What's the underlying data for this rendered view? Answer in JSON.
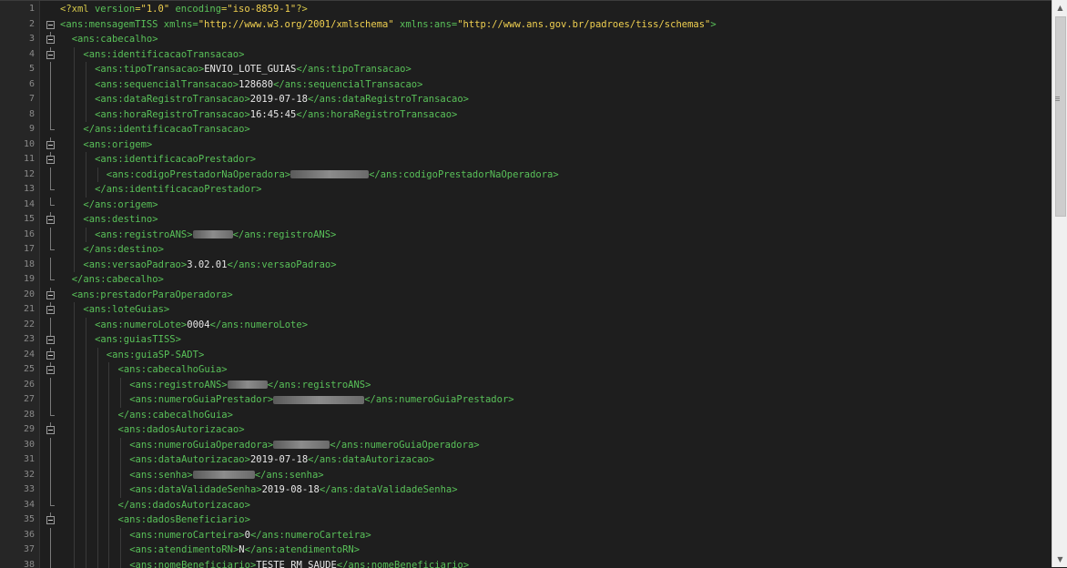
{
  "editor": {
    "lines": [
      {
        "n": "1",
        "indent": 0,
        "fold": "none",
        "segs": [
          [
            "pi",
            "<?xml "
          ],
          [
            "attrn",
            "version"
          ],
          [
            "pi",
            "="
          ],
          [
            "attrv",
            "\"1.0\""
          ],
          [
            "pi",
            " "
          ],
          [
            "attrn",
            "encoding"
          ],
          [
            "pi",
            "="
          ],
          [
            "attrv",
            "\"iso-8859-1\""
          ],
          [
            "pi",
            "?>"
          ]
        ]
      },
      {
        "n": "2",
        "indent": 0,
        "fold": "open",
        "segs": [
          [
            "tag",
            "<ans:mensagemTISS "
          ],
          [
            "attrn",
            "xmlns"
          ],
          [
            "tag",
            "="
          ],
          [
            "attrv",
            "\"http://www.w3.org/2001/xmlschema\""
          ],
          [
            "tag",
            " "
          ],
          [
            "attrn",
            "xmlns:ans"
          ],
          [
            "tag",
            "="
          ],
          [
            "attrv",
            "\"http://www.ans.gov.br/padroes/tiss/schemas\""
          ],
          [
            "tag",
            ">"
          ]
        ]
      },
      {
        "n": "3",
        "indent": 1,
        "fold": "open",
        "segs": [
          [
            "tag",
            "<ans:cabecalho>"
          ]
        ]
      },
      {
        "n": "4",
        "indent": 2,
        "fold": "open",
        "segs": [
          [
            "tag",
            "<ans:identificacaoTransacao>"
          ]
        ]
      },
      {
        "n": "5",
        "indent": 3,
        "fold": "line",
        "segs": [
          [
            "tag",
            "<ans:tipoTransacao>"
          ],
          [
            "txt",
            "ENVIO_LOTE_GUIAS"
          ],
          [
            "tag",
            "</ans:tipoTransacao>"
          ]
        ]
      },
      {
        "n": "6",
        "indent": 3,
        "fold": "line",
        "segs": [
          [
            "tag",
            "<ans:sequencialTransacao>"
          ],
          [
            "txt",
            "128680"
          ],
          [
            "tag",
            "</ans:sequencialTransacao>"
          ]
        ]
      },
      {
        "n": "7",
        "indent": 3,
        "fold": "line",
        "segs": [
          [
            "tag",
            "<ans:dataRegistroTransacao>"
          ],
          [
            "txt",
            "2019-07-18"
          ],
          [
            "tag",
            "</ans:dataRegistroTransacao>"
          ]
        ]
      },
      {
        "n": "8",
        "indent": 3,
        "fold": "line",
        "segs": [
          [
            "tag",
            "<ans:horaRegistroTransacao>"
          ],
          [
            "txt",
            "16:45:45"
          ],
          [
            "tag",
            "</ans:horaRegistroTransacao>"
          ]
        ]
      },
      {
        "n": "9",
        "indent": 2,
        "fold": "end",
        "segs": [
          [
            "tag",
            "</ans:identificacaoTransacao>"
          ]
        ]
      },
      {
        "n": "10",
        "indent": 2,
        "fold": "open",
        "segs": [
          [
            "tag",
            "<ans:origem>"
          ]
        ]
      },
      {
        "n": "11",
        "indent": 3,
        "fold": "open",
        "segs": [
          [
            "tag",
            "<ans:identificacaoPrestador>"
          ]
        ]
      },
      {
        "n": "12",
        "indent": 4,
        "fold": "line",
        "segs": [
          [
            "tag",
            "<ans:codigoPrestadorNaOperadora>"
          ],
          [
            "redact",
            "86"
          ],
          [
            "tag",
            "</ans:codigoPrestadorNaOperadora>"
          ]
        ]
      },
      {
        "n": "13",
        "indent": 3,
        "fold": "end",
        "segs": [
          [
            "tag",
            "</ans:identificacaoPrestador>"
          ]
        ]
      },
      {
        "n": "14",
        "indent": 2,
        "fold": "end",
        "segs": [
          [
            "tag",
            "</ans:origem>"
          ]
        ]
      },
      {
        "n": "15",
        "indent": 2,
        "fold": "open",
        "segs": [
          [
            "tag",
            "<ans:destino>"
          ]
        ]
      },
      {
        "n": "16",
        "indent": 3,
        "fold": "line",
        "segs": [
          [
            "tag",
            "<ans:registroANS>"
          ],
          [
            "redact",
            "44"
          ],
          [
            "tag",
            "</ans:registroANS>"
          ]
        ]
      },
      {
        "n": "17",
        "indent": 2,
        "fold": "end",
        "segs": [
          [
            "tag",
            "</ans:destino>"
          ]
        ]
      },
      {
        "n": "18",
        "indent": 2,
        "fold": "line",
        "segs": [
          [
            "tag",
            "<ans:versaoPadrao>"
          ],
          [
            "txt",
            "3.02.01"
          ],
          [
            "tag",
            "</ans:versaoPadrao>"
          ]
        ]
      },
      {
        "n": "19",
        "indent": 1,
        "fold": "end",
        "segs": [
          [
            "tag",
            "</ans:cabecalho>"
          ]
        ]
      },
      {
        "n": "20",
        "indent": 1,
        "fold": "open",
        "segs": [
          [
            "tag",
            "<ans:prestadorParaOperadora>"
          ]
        ]
      },
      {
        "n": "21",
        "indent": 2,
        "fold": "open",
        "segs": [
          [
            "tag",
            "<ans:loteGuias>"
          ]
        ]
      },
      {
        "n": "22",
        "indent": 3,
        "fold": "line",
        "segs": [
          [
            "tag",
            "<ans:numeroLote>"
          ],
          [
            "txt",
            "0004"
          ],
          [
            "tag",
            "</ans:numeroLote>"
          ]
        ]
      },
      {
        "n": "23",
        "indent": 3,
        "fold": "open",
        "segs": [
          [
            "tag",
            "<ans:guiasTISS>"
          ]
        ]
      },
      {
        "n": "24",
        "indent": 4,
        "fold": "open",
        "segs": [
          [
            "tag",
            "<ans:guiaSP-SADT>"
          ]
        ]
      },
      {
        "n": "25",
        "indent": 5,
        "fold": "open",
        "segs": [
          [
            "tag",
            "<ans:cabecalhoGuia>"
          ]
        ]
      },
      {
        "n": "26",
        "indent": 6,
        "fold": "line",
        "segs": [
          [
            "tag",
            "<ans:registroANS>"
          ],
          [
            "redact",
            "44"
          ],
          [
            "tag",
            "</ans:registroANS>"
          ]
        ]
      },
      {
        "n": "27",
        "indent": 6,
        "fold": "line",
        "segs": [
          [
            "tag",
            "<ans:numeroGuiaPrestador>"
          ],
          [
            "redact",
            "100"
          ],
          [
            "tag",
            "</ans:numeroGuiaPrestador>"
          ]
        ]
      },
      {
        "n": "28",
        "indent": 5,
        "fold": "end",
        "segs": [
          [
            "tag",
            "</ans:cabecalhoGuia>"
          ]
        ]
      },
      {
        "n": "29",
        "indent": 5,
        "fold": "open",
        "segs": [
          [
            "tag",
            "<ans:dadosAutorizacao>"
          ]
        ]
      },
      {
        "n": "30",
        "indent": 6,
        "fold": "line",
        "segs": [
          [
            "tag",
            "<ans:numeroGuiaOperadora>"
          ],
          [
            "redact",
            "62"
          ],
          [
            "tag",
            "</ans:numeroGuiaOperadora>"
          ]
        ]
      },
      {
        "n": "31",
        "indent": 6,
        "fold": "line",
        "segs": [
          [
            "tag",
            "<ans:dataAutorizacao>"
          ],
          [
            "txt",
            "2019-07-18"
          ],
          [
            "tag",
            "</ans:dataAutorizacao>"
          ]
        ]
      },
      {
        "n": "32",
        "indent": 6,
        "fold": "line",
        "segs": [
          [
            "tag",
            "<ans:senha>"
          ],
          [
            "redact",
            "68"
          ],
          [
            "tag",
            "</ans:senha>"
          ]
        ]
      },
      {
        "n": "33",
        "indent": 6,
        "fold": "line",
        "segs": [
          [
            "tag",
            "<ans:dataValidadeSenha>"
          ],
          [
            "txt",
            "2019-08-18"
          ],
          [
            "tag",
            "</ans:dataValidadeSenha>"
          ]
        ]
      },
      {
        "n": "34",
        "indent": 5,
        "fold": "end",
        "segs": [
          [
            "tag",
            "</ans:dadosAutorizacao>"
          ]
        ]
      },
      {
        "n": "35",
        "indent": 5,
        "fold": "open",
        "segs": [
          [
            "tag",
            "<ans:dadosBeneficiario>"
          ]
        ]
      },
      {
        "n": "36",
        "indent": 6,
        "fold": "line",
        "segs": [
          [
            "tag",
            "<ans:numeroCarteira>"
          ],
          [
            "txt",
            "0"
          ],
          [
            "tag",
            "</ans:numeroCarteira>"
          ]
        ]
      },
      {
        "n": "37",
        "indent": 6,
        "fold": "line",
        "segs": [
          [
            "tag",
            "<ans:atendimentoRN>"
          ],
          [
            "txt",
            "N"
          ],
          [
            "tag",
            "</ans:atendimentoRN>"
          ]
        ]
      },
      {
        "n": "38",
        "indent": 6,
        "fold": "line",
        "segs": [
          [
            "tag",
            "<ans:nomeBeneficiario>"
          ],
          [
            "txt",
            "TESTE RM SAUDE"
          ],
          [
            "tag",
            "</ans:nomeBeneficiario>"
          ]
        ]
      }
    ]
  },
  "scrollbar": {
    "up_icon": "arrow-up-icon",
    "down_icon": "arrow-down-icon",
    "up_glyph": "▲",
    "down_glyph": "▼"
  },
  "colors": {
    "background": "#1e1e1e",
    "tag": "#59c159",
    "attribute_value": "#f0d050",
    "text": "#e8e8e8",
    "line_number": "#8a8a8a"
  }
}
